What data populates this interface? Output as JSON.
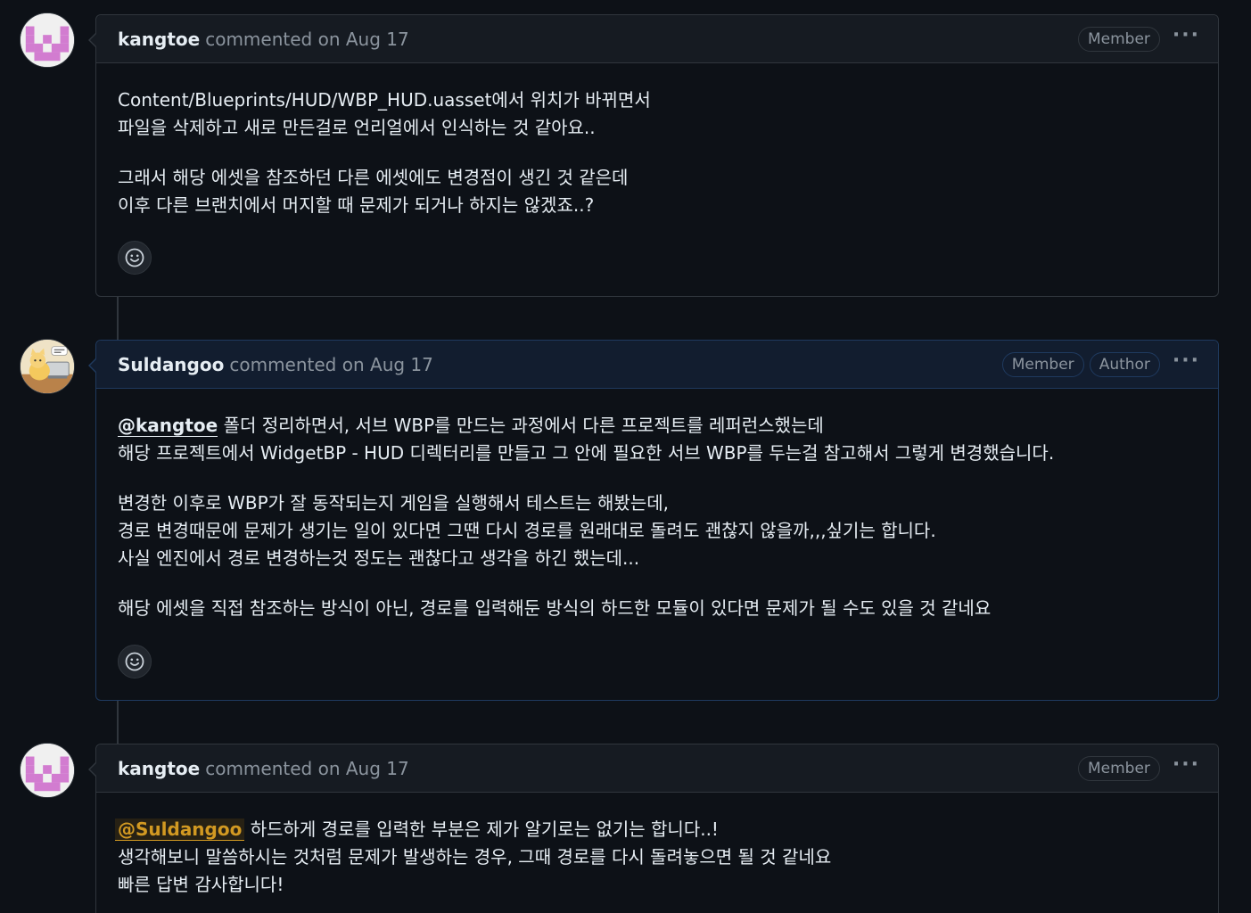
{
  "comments": [
    {
      "author": "kangtoe",
      "meta": "commented on Aug 17",
      "badges": [
        "Member"
      ],
      "paragraphs": [
        [
          "Content/Blueprints/HUD/WBP_HUD.uasset에서 위치가 바뀌면서",
          "파일을 삭제하고 새로 만든걸로 언리얼에서 인식하는 것 같아요.."
        ],
        [
          "그래서 해당 에셋을 참조하던 다른 에셋에도 변경점이 생긴 것 같은데",
          "이후 다른 브랜치에서 머지할 때 문제가 되거나 하지는 않겠죠..?"
        ]
      ],
      "reaction_icon": "smiley-icon"
    },
    {
      "author": "Suldangoo",
      "meta": "commented on Aug 17",
      "badges": [
        "Member",
        "Author"
      ],
      "mention": "@kangtoe",
      "first_line_rest": " 폴더 정리하면서, 서브 WBP를 만드는 과정에서 다른 프로젝트를 레퍼런스했는데",
      "paragraphs": [
        [
          "해당 프로젝트에서 WidgetBP - HUD 디렉터리를 만들고 그 안에 필요한 서브 WBP를 두는걸 참고해서 그렇게 변경했습니다."
        ],
        [
          "변경한 이후로 WBP가 잘 동작되는지 게임을 실행해서 테스트는 해봤는데,",
          "경로 변경때문에 문제가 생기는 일이 있다면 그땐 다시 경로를 원래대로 돌려도 괜찮지 않을까,,,싶기는 합니다.",
          "사실 엔진에서 경로 변경하는것 정도는 괜찮다고 생각을 하긴 했는데..."
        ],
        [
          "해당 에셋을 직접 참조하는 방식이 아닌, 경로를 입력해둔 방식의 하드한 모듈이 있다면 문제가 될 수도 있을 것 같네요"
        ]
      ],
      "reaction_icon": "smiley-icon"
    },
    {
      "author": "kangtoe",
      "meta": "commented on Aug 17",
      "badges": [
        "Member"
      ],
      "mention": "@Suldangoo",
      "first_line_rest": " 하드하게 경로를 입력한 부분은 제가 알기로는 없기는 합니다..!",
      "paragraphs": [
        [
          "생각해보니 말씀하시는 것처럼 문제가 발생하는 경우, 그때 경로를 다시 돌려놓으면 될 것 같네요",
          "빠른 답변 감사합니다!"
        ]
      ]
    }
  ],
  "kebab_icon": "kebab-horizontal-icon",
  "colors": {
    "background": "#0d1117",
    "header": "#161b22",
    "author_header": "#121d2f",
    "border": "#30363d",
    "muted": "#8b949e",
    "mention_highlight": "#d29922"
  }
}
